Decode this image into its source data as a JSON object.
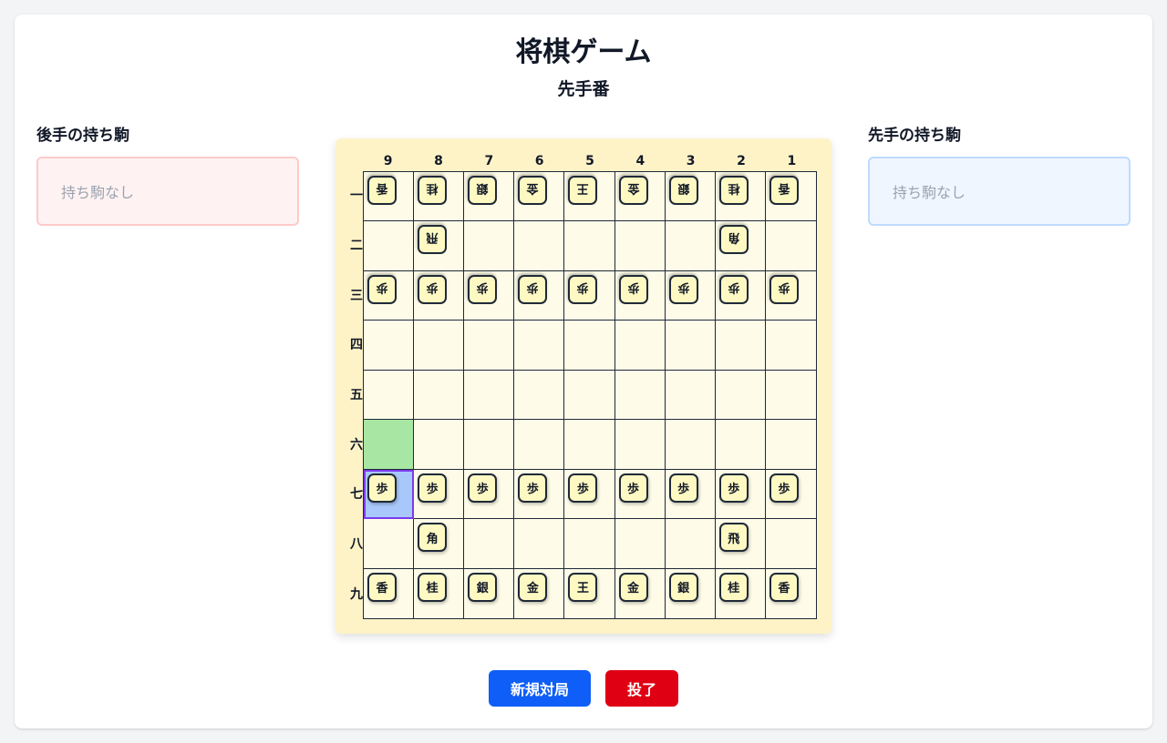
{
  "title": "将棋ゲーム",
  "turn": "先手番",
  "gote_hand": {
    "label": "後手の持ち駒",
    "empty_text": "持ち駒なし"
  },
  "sente_hand": {
    "label": "先手の持ち駒",
    "empty_text": "持ち駒なし"
  },
  "board": {
    "files": [
      "9",
      "8",
      "7",
      "6",
      "5",
      "4",
      "3",
      "2",
      "1"
    ],
    "ranks": [
      "一",
      "二",
      "三",
      "四",
      "五",
      "六",
      "七",
      "八",
      "九"
    ],
    "rows": [
      [
        {
          "p": "香",
          "o": "gote"
        },
        {
          "p": "桂",
          "o": "gote"
        },
        {
          "p": "銀",
          "o": "gote"
        },
        {
          "p": "金",
          "o": "gote"
        },
        {
          "p": "王",
          "o": "gote"
        },
        {
          "p": "金",
          "o": "gote"
        },
        {
          "p": "銀",
          "o": "gote"
        },
        {
          "p": "桂",
          "o": "gote"
        },
        {
          "p": "香",
          "o": "gote"
        }
      ],
      [
        null,
        {
          "p": "飛",
          "o": "gote"
        },
        null,
        null,
        null,
        null,
        null,
        {
          "p": "角",
          "o": "gote"
        },
        null
      ],
      [
        {
          "p": "歩",
          "o": "gote"
        },
        {
          "p": "歩",
          "o": "gote"
        },
        {
          "p": "歩",
          "o": "gote"
        },
        {
          "p": "歩",
          "o": "gote"
        },
        {
          "p": "歩",
          "o": "gote"
        },
        {
          "p": "歩",
          "o": "gote"
        },
        {
          "p": "歩",
          "o": "gote"
        },
        {
          "p": "歩",
          "o": "gote"
        },
        {
          "p": "歩",
          "o": "gote"
        }
      ],
      [
        null,
        null,
        null,
        null,
        null,
        null,
        null,
        null,
        null
      ],
      [
        null,
        null,
        null,
        null,
        null,
        null,
        null,
        null,
        null
      ],
      [
        null,
        null,
        null,
        null,
        null,
        null,
        null,
        null,
        null
      ],
      [
        {
          "p": "歩",
          "o": "sente"
        },
        {
          "p": "歩",
          "o": "sente"
        },
        {
          "p": "歩",
          "o": "sente"
        },
        {
          "p": "歩",
          "o": "sente"
        },
        {
          "p": "歩",
          "o": "sente"
        },
        {
          "p": "歩",
          "o": "sente"
        },
        {
          "p": "歩",
          "o": "sente"
        },
        {
          "p": "歩",
          "o": "sente"
        },
        {
          "p": "歩",
          "o": "sente"
        }
      ],
      [
        null,
        {
          "p": "角",
          "o": "sente"
        },
        null,
        null,
        null,
        null,
        null,
        {
          "p": "飛",
          "o": "sente"
        },
        null
      ],
      [
        {
          "p": "香",
          "o": "sente"
        },
        {
          "p": "桂",
          "o": "sente"
        },
        {
          "p": "銀",
          "o": "sente"
        },
        {
          "p": "金",
          "o": "sente"
        },
        {
          "p": "王",
          "o": "sente"
        },
        {
          "p": "金",
          "o": "sente"
        },
        {
          "p": "銀",
          "o": "sente"
        },
        {
          "p": "桂",
          "o": "sente"
        },
        {
          "p": "香",
          "o": "sente"
        }
      ]
    ],
    "selected_square": {
      "file": "9",
      "rank": "七"
    },
    "legal_move_squares": [
      {
        "file": "9",
        "rank": "六"
      }
    ]
  },
  "buttons": {
    "new_game": "新規対局",
    "resign": "投了"
  },
  "colors": {
    "board_bg": "#fef3c7",
    "cell_bg": "#fefce8",
    "piece_bg": "#fef9c3",
    "selected": "#a8c8fb",
    "legal_move": "#a7e6a3",
    "new_game_button": "#0f5ef7",
    "resign_button": "#e00014"
  }
}
